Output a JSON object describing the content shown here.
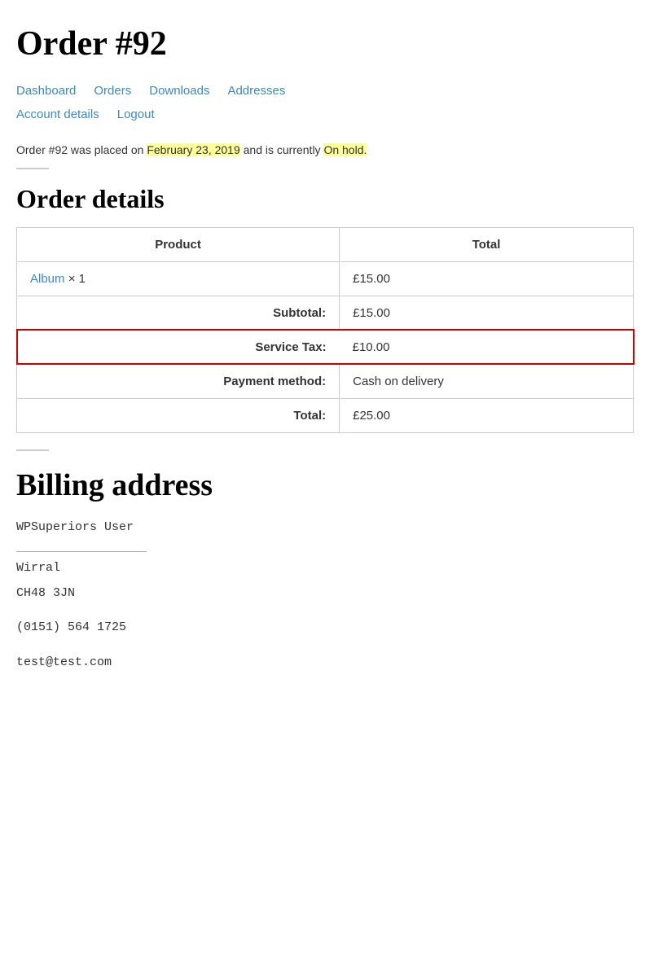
{
  "page": {
    "title": "Order #92"
  },
  "nav": {
    "links": [
      {
        "label": "Dashboard",
        "href": "#"
      },
      {
        "label": "Orders",
        "href": "#"
      },
      {
        "label": "Downloads",
        "href": "#"
      },
      {
        "label": "Addresses",
        "href": "#"
      },
      {
        "label": "Account details",
        "href": "#"
      },
      {
        "label": "Logout",
        "href": "#"
      }
    ]
  },
  "order": {
    "status_prefix": "Order #92 was placed on ",
    "date": "February 23, 2019",
    "status_middle": " and is currently ",
    "status": "On hold.",
    "order_number": "92"
  },
  "order_details": {
    "section_title": "Order details",
    "table": {
      "col_product": "Product",
      "col_total": "Total",
      "rows": [
        {
          "product_link": "Album",
          "product_qty": "× 1",
          "total": "£15.00"
        }
      ],
      "subtotal_label": "Subtotal:",
      "subtotal_value": "£15.00",
      "service_tax_label": "Service Tax:",
      "service_tax_value": "£10.00",
      "payment_method_label": "Payment method:",
      "payment_method_value": "Cash on delivery",
      "total_label": "Total:",
      "total_value": "£25.00"
    }
  },
  "billing": {
    "section_title": "Billing address",
    "name": "WPSuperiors User",
    "address_line2": "",
    "city": "Wirral",
    "postcode": "CH48 3JN",
    "phone": "(0151) 564 1725",
    "email": "test@test.com"
  }
}
